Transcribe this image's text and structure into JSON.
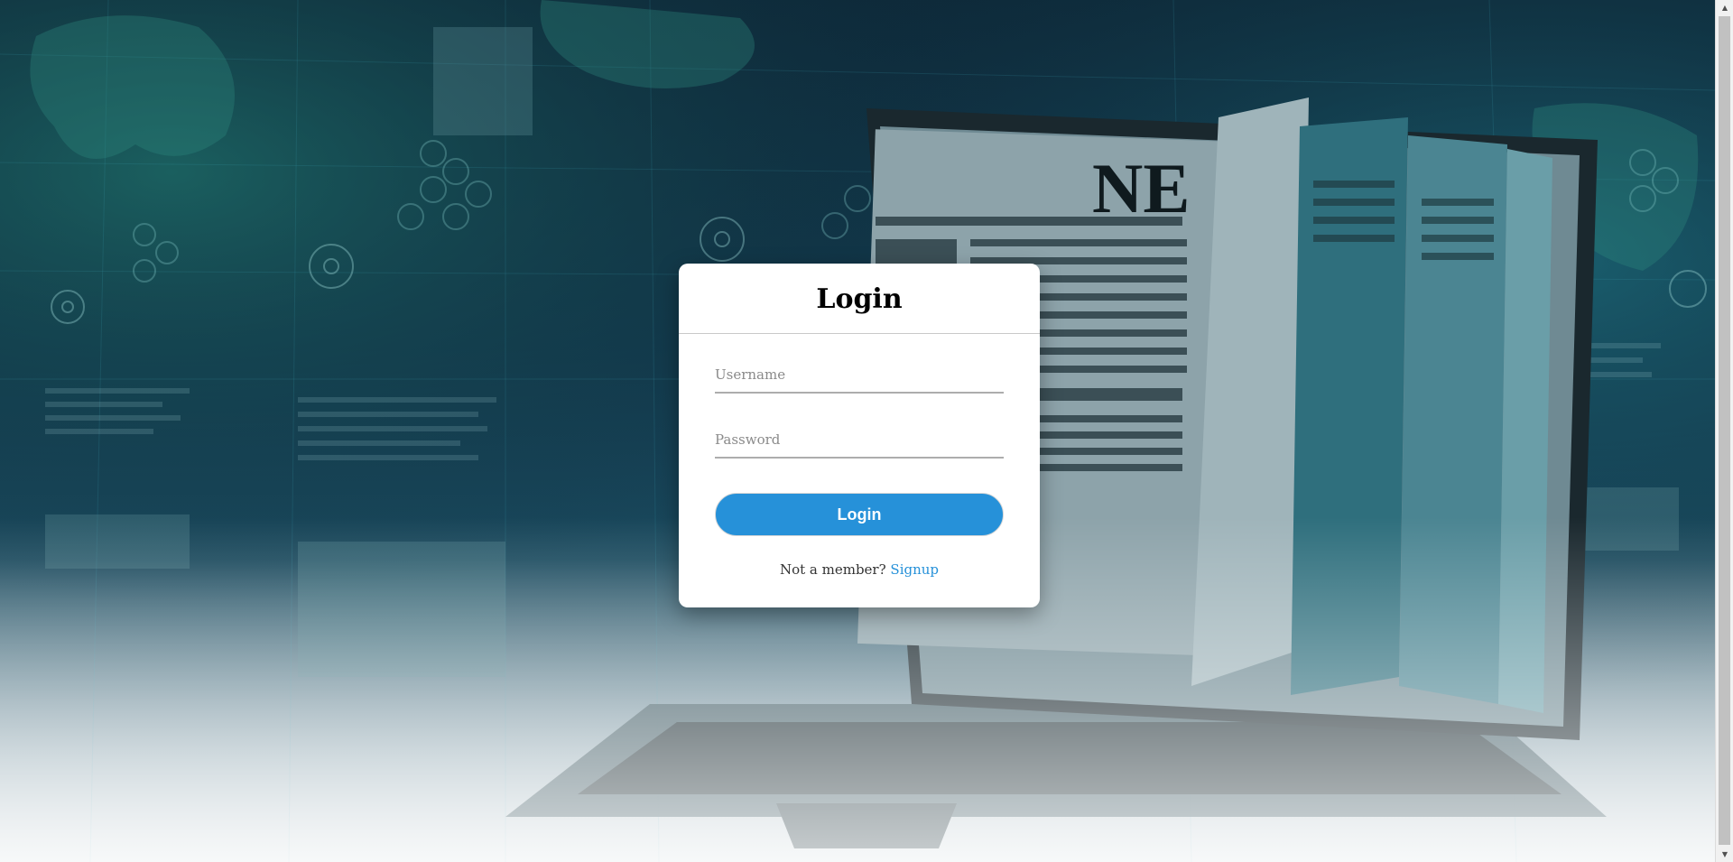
{
  "login": {
    "title": "Login",
    "username_placeholder": "Username",
    "password_placeholder": "Password",
    "button_label": "Login",
    "signup_prompt": "Not a member?",
    "signup_link": "Signup"
  },
  "colors": {
    "accent": "#2691d9",
    "card_background": "#ffffff",
    "page_background": "#12384c"
  },
  "icons": {
    "scroll_up": "scroll-up-arrow-icon",
    "scroll_down": "scroll-down-arrow-icon"
  }
}
